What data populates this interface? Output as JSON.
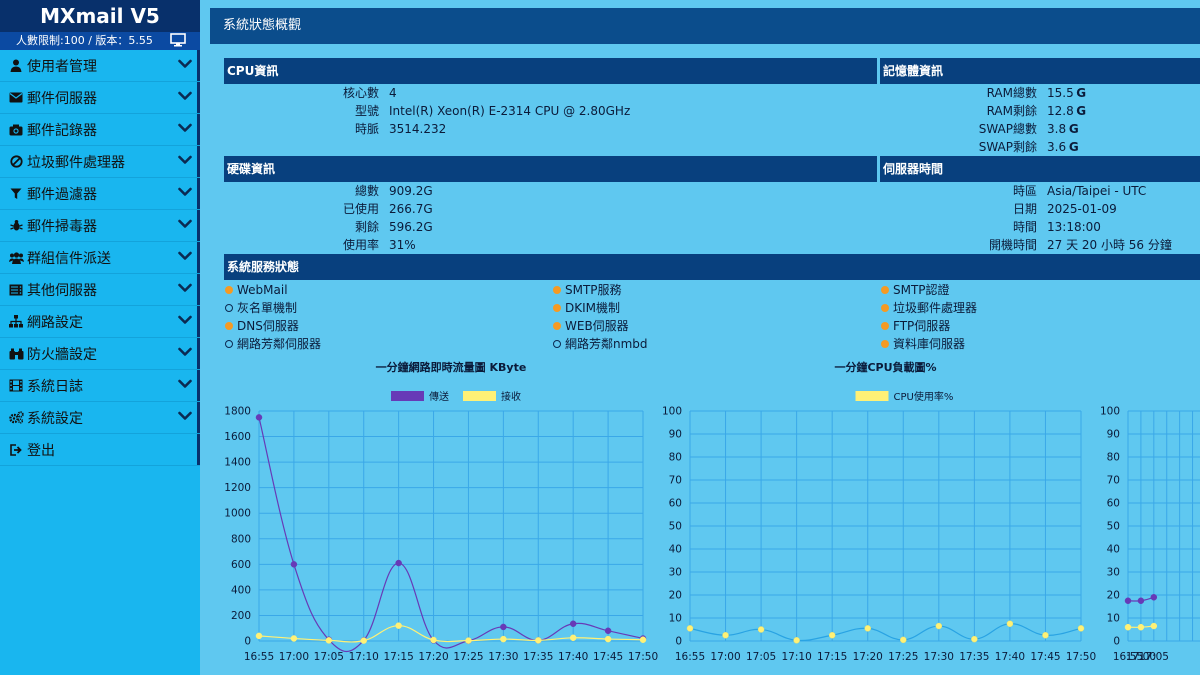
{
  "sidebar": {
    "app_title": "MXmail V5",
    "limit_text": "人數限制:100 / 版本：5.55",
    "items": [
      {
        "label": "使用者管理",
        "icon": "user-icon"
      },
      {
        "label": "郵件伺服器",
        "icon": "envelope-icon"
      },
      {
        "label": "郵件記錄器",
        "icon": "camera-icon"
      },
      {
        "label": "垃圾郵件處理器",
        "icon": "ban-icon"
      },
      {
        "label": "郵件過濾器",
        "icon": "filter-icon"
      },
      {
        "label": "郵件掃毒器",
        "icon": "bug-icon"
      },
      {
        "label": "群組信件派送",
        "icon": "users-icon"
      },
      {
        "label": "其他伺服器",
        "icon": "server-icon"
      },
      {
        "label": "網路設定",
        "icon": "sitemap-icon"
      },
      {
        "label": "防火牆設定",
        "icon": "binoculars-icon"
      },
      {
        "label": "系統日誌",
        "icon": "film-icon"
      },
      {
        "label": "系統設定",
        "icon": "cogs-icon"
      },
      {
        "label": "登出",
        "icon": "sign-out-icon"
      }
    ]
  },
  "page": {
    "title": "系統狀態概觀"
  },
  "cpu": {
    "title": "CPU資訊",
    "rows": [
      {
        "label": "核心數",
        "value": "4"
      },
      {
        "label": "型號",
        "value": "Intel(R) Xeon(R) E-2314 CPU @ 2.80GHz"
      },
      {
        "label": "時脈",
        "value": "3514.232"
      }
    ]
  },
  "memory": {
    "title": "記憶體資訊",
    "rows": [
      {
        "label": "RAM總數",
        "value": "15.5",
        "unit": "G"
      },
      {
        "label": "RAM剩餘",
        "value": "12.8",
        "unit": "G"
      },
      {
        "label": "SWAP總數",
        "value": "3.8",
        "unit": "G"
      },
      {
        "label": "SWAP剩餘",
        "value": "3.6",
        "unit": "G"
      }
    ]
  },
  "disk": {
    "title": "硬碟資訊",
    "rows": [
      {
        "label": "總數",
        "value": "909.2G"
      },
      {
        "label": "已使用",
        "value": "266.7G"
      },
      {
        "label": "剩餘",
        "value": "596.2G"
      },
      {
        "label": "使用率",
        "value": "31%"
      }
    ]
  },
  "server_time": {
    "title": "伺服器時間",
    "rows": [
      {
        "label": "時區",
        "value": "Asia/Taipei - UTC"
      },
      {
        "label": "日期",
        "value": "2025-01-09"
      },
      {
        "label": "時間",
        "value": "13:18:00"
      },
      {
        "label": "開機時間",
        "value": "27 天 20 小時 56 分鐘"
      }
    ]
  },
  "services": {
    "title": "系統服務狀態",
    "items": [
      {
        "name": "WebMail",
        "active": true
      },
      {
        "name": "SMTP服務",
        "active": true
      },
      {
        "name": "SMTP認證",
        "active": true
      },
      {
        "name": "灰名單機制",
        "active": false
      },
      {
        "name": "DKIM機制",
        "active": true
      },
      {
        "name": "垃圾郵件處理器",
        "active": true
      },
      {
        "name": "DNS伺服器",
        "active": true
      },
      {
        "name": "WEB伺服器",
        "active": true
      },
      {
        "name": "FTP伺服器",
        "active": true
      },
      {
        "name": "網路芳鄰伺服器",
        "active": false
      },
      {
        "name": "網路芳鄰nmbd",
        "active": false
      },
      {
        "name": "資料庫伺服器",
        "active": true
      }
    ]
  },
  "colors": {
    "send": "#673ab7",
    "receive": "#fff176",
    "cpu": "#fff176",
    "active_dot": "#f59a23",
    "header": "#08407e"
  },
  "chart_data": [
    {
      "type": "line",
      "title": "一分鐘網路即時流量圖 KByte",
      "x": [
        "16:55",
        "17:00",
        "17:05",
        "17:10",
        "17:15",
        "17:20",
        "17:25",
        "17:30",
        "17:35",
        "17:40",
        "17:45",
        "17:50"
      ],
      "series": [
        {
          "name": "傳送",
          "values": [
            1750,
            600,
            10,
            5,
            610,
            5,
            2,
            110,
            5,
            135,
            80,
            20
          ]
        },
        {
          "name": "接收",
          "values": [
            40,
            20,
            5,
            3,
            120,
            8,
            3,
            15,
            5,
            25,
            15,
            10
          ]
        }
      ],
      "ylim": [
        0,
        1800
      ],
      "yticks": [
        0,
        200,
        400,
        600,
        800,
        1000,
        1200,
        1400,
        1600,
        1800
      ],
      "legend": "top"
    },
    {
      "type": "line",
      "title": "一分鐘CPU負載圖%",
      "x": [
        "16:55",
        "17:00",
        "17:05",
        "17:10",
        "17:15",
        "17:20",
        "17:25",
        "17:30",
        "17:35",
        "17:40",
        "17:45",
        "17:50"
      ],
      "series": [
        {
          "name": "CPU使用率%",
          "values": [
            5.5,
            2.5,
            5,
            0.3,
            2.5,
            5.5,
            0.5,
            6.5,
            0.8,
            7.5,
            2.5,
            5.5
          ]
        }
      ],
      "ylim": [
        0,
        100
      ],
      "yticks": [
        0,
        10,
        20,
        30,
        40,
        50,
        60,
        70,
        80,
        90,
        100
      ],
      "legend": "top"
    },
    {
      "type": "line",
      "x": [
        "16:55",
        "17:00",
        "17:05"
      ],
      "series": [
        {
          "values": [
            17.5,
            17.5,
            19
          ]
        },
        {
          "values": [
            6,
            6,
            6.5
          ]
        }
      ],
      "ylim": [
        0,
        100
      ],
      "yticks": [
        0,
        10,
        20,
        30,
        40,
        50,
        60,
        70,
        80,
        90,
        100
      ]
    }
  ]
}
